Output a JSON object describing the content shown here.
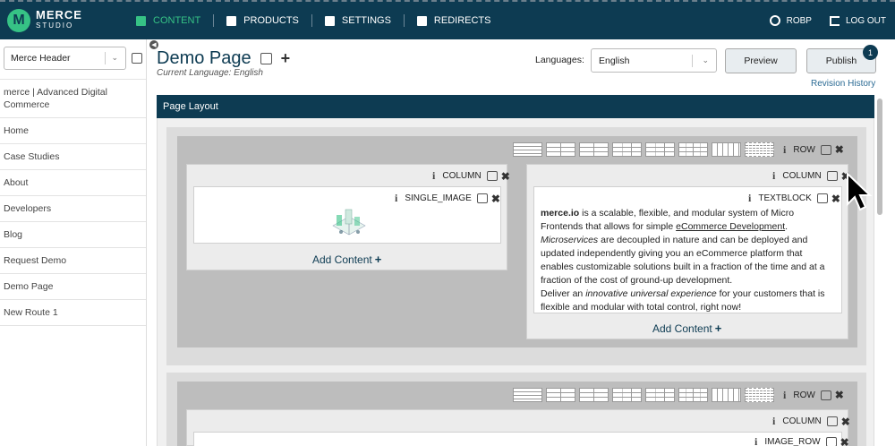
{
  "brand": {
    "name": "MERCE",
    "subtitle": "STUDIO",
    "badge": "M",
    "accent": "#36c285",
    "primary": "#0d3b52"
  },
  "nav": {
    "items": [
      {
        "label": "CONTENT",
        "icon": "document-icon",
        "active": true
      },
      {
        "label": "PRODUCTS",
        "icon": "box-icon"
      },
      {
        "label": "SETTINGS",
        "icon": "user-gear-icon"
      },
      {
        "label": "REDIRECTS",
        "icon": "signpost-icon"
      }
    ],
    "user": "ROBP",
    "logout": "LOG OUT"
  },
  "sidebar": {
    "selector_value": "Merce Header",
    "items": [
      "merce | Advanced Digital Commerce",
      "Home",
      "Case Studies",
      "About",
      "Developers",
      "Blog",
      "Request Demo",
      "Demo Page",
      "New Route 1"
    ]
  },
  "page": {
    "title": "Demo Page",
    "current_language": "Current Language: English",
    "languages_label": "Languages:",
    "language_value": "English",
    "preview_label": "Preview",
    "publish_label": "Publish",
    "publish_badge": "1",
    "revision_history": "Revision History",
    "layout_title": "Page Layout"
  },
  "layout": {
    "row_label": "ROW",
    "column_label": "COLUMN",
    "single_image_label": "SINGLE_IMAGE",
    "textblock_label": "TEXTBLOCK",
    "image_row_label": "IMAGE_ROW",
    "add_content": "Add Content",
    "textblock": {
      "p1_bold": "merce.io",
      "p1_a": " is a scalable, flexible, and modular system of Micro Frontends that allows for simple ",
      "p1_link": "eCommerce Development",
      "p1_b": ". ",
      "p1_italic": "Microservices",
      "p1_c": " are decoupled in nature and can be deployed and updated independently giving you an eCommerce platform that enables customizable solutions built in a fraction of the time and at a fraction of the cost of ground-up development.",
      "p2_a": "Deliver an ",
      "p2_italic": "innovative universal experience",
      "p2_b": " for your customers that is flexible and modular with total control, right now!"
    }
  }
}
